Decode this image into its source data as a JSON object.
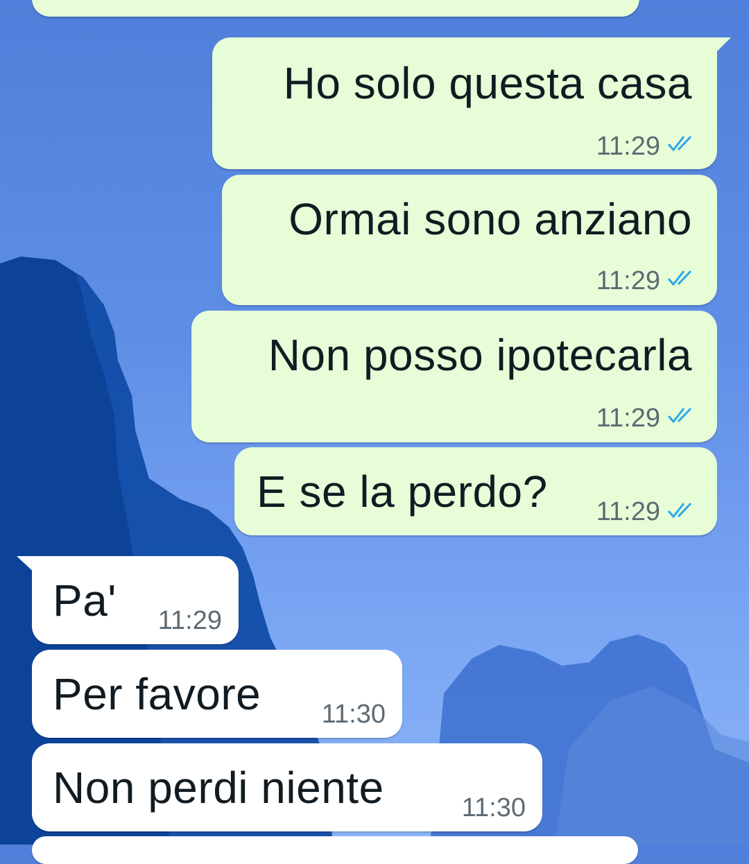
{
  "colors": {
    "outgoing_bubble": "#e6fdd8",
    "incoming_bubble": "#ffffff",
    "read_ticks": "#2aa8e8",
    "wallpaper": "#5f8ee6"
  },
  "messages": [
    {
      "direction": "outgoing",
      "text": "Ho solo questa casa",
      "time": "11:29",
      "status_icon": "double-check-read-icon"
    },
    {
      "direction": "outgoing",
      "text": "Ormai sono anziano",
      "time": "11:29",
      "status_icon": "double-check-read-icon"
    },
    {
      "direction": "outgoing",
      "text": "Non posso ipotecarla",
      "time": "11:29",
      "status_icon": "double-check-read-icon"
    },
    {
      "direction": "outgoing",
      "text": "E se la perdo?",
      "time": "11:29",
      "status_icon": "double-check-read-icon"
    },
    {
      "direction": "incoming",
      "text": "Pa'",
      "time": "11:29"
    },
    {
      "direction": "incoming",
      "text": "Per favore",
      "time": "11:30"
    },
    {
      "direction": "incoming",
      "text": "Non perdi niente",
      "time": "11:30"
    }
  ]
}
